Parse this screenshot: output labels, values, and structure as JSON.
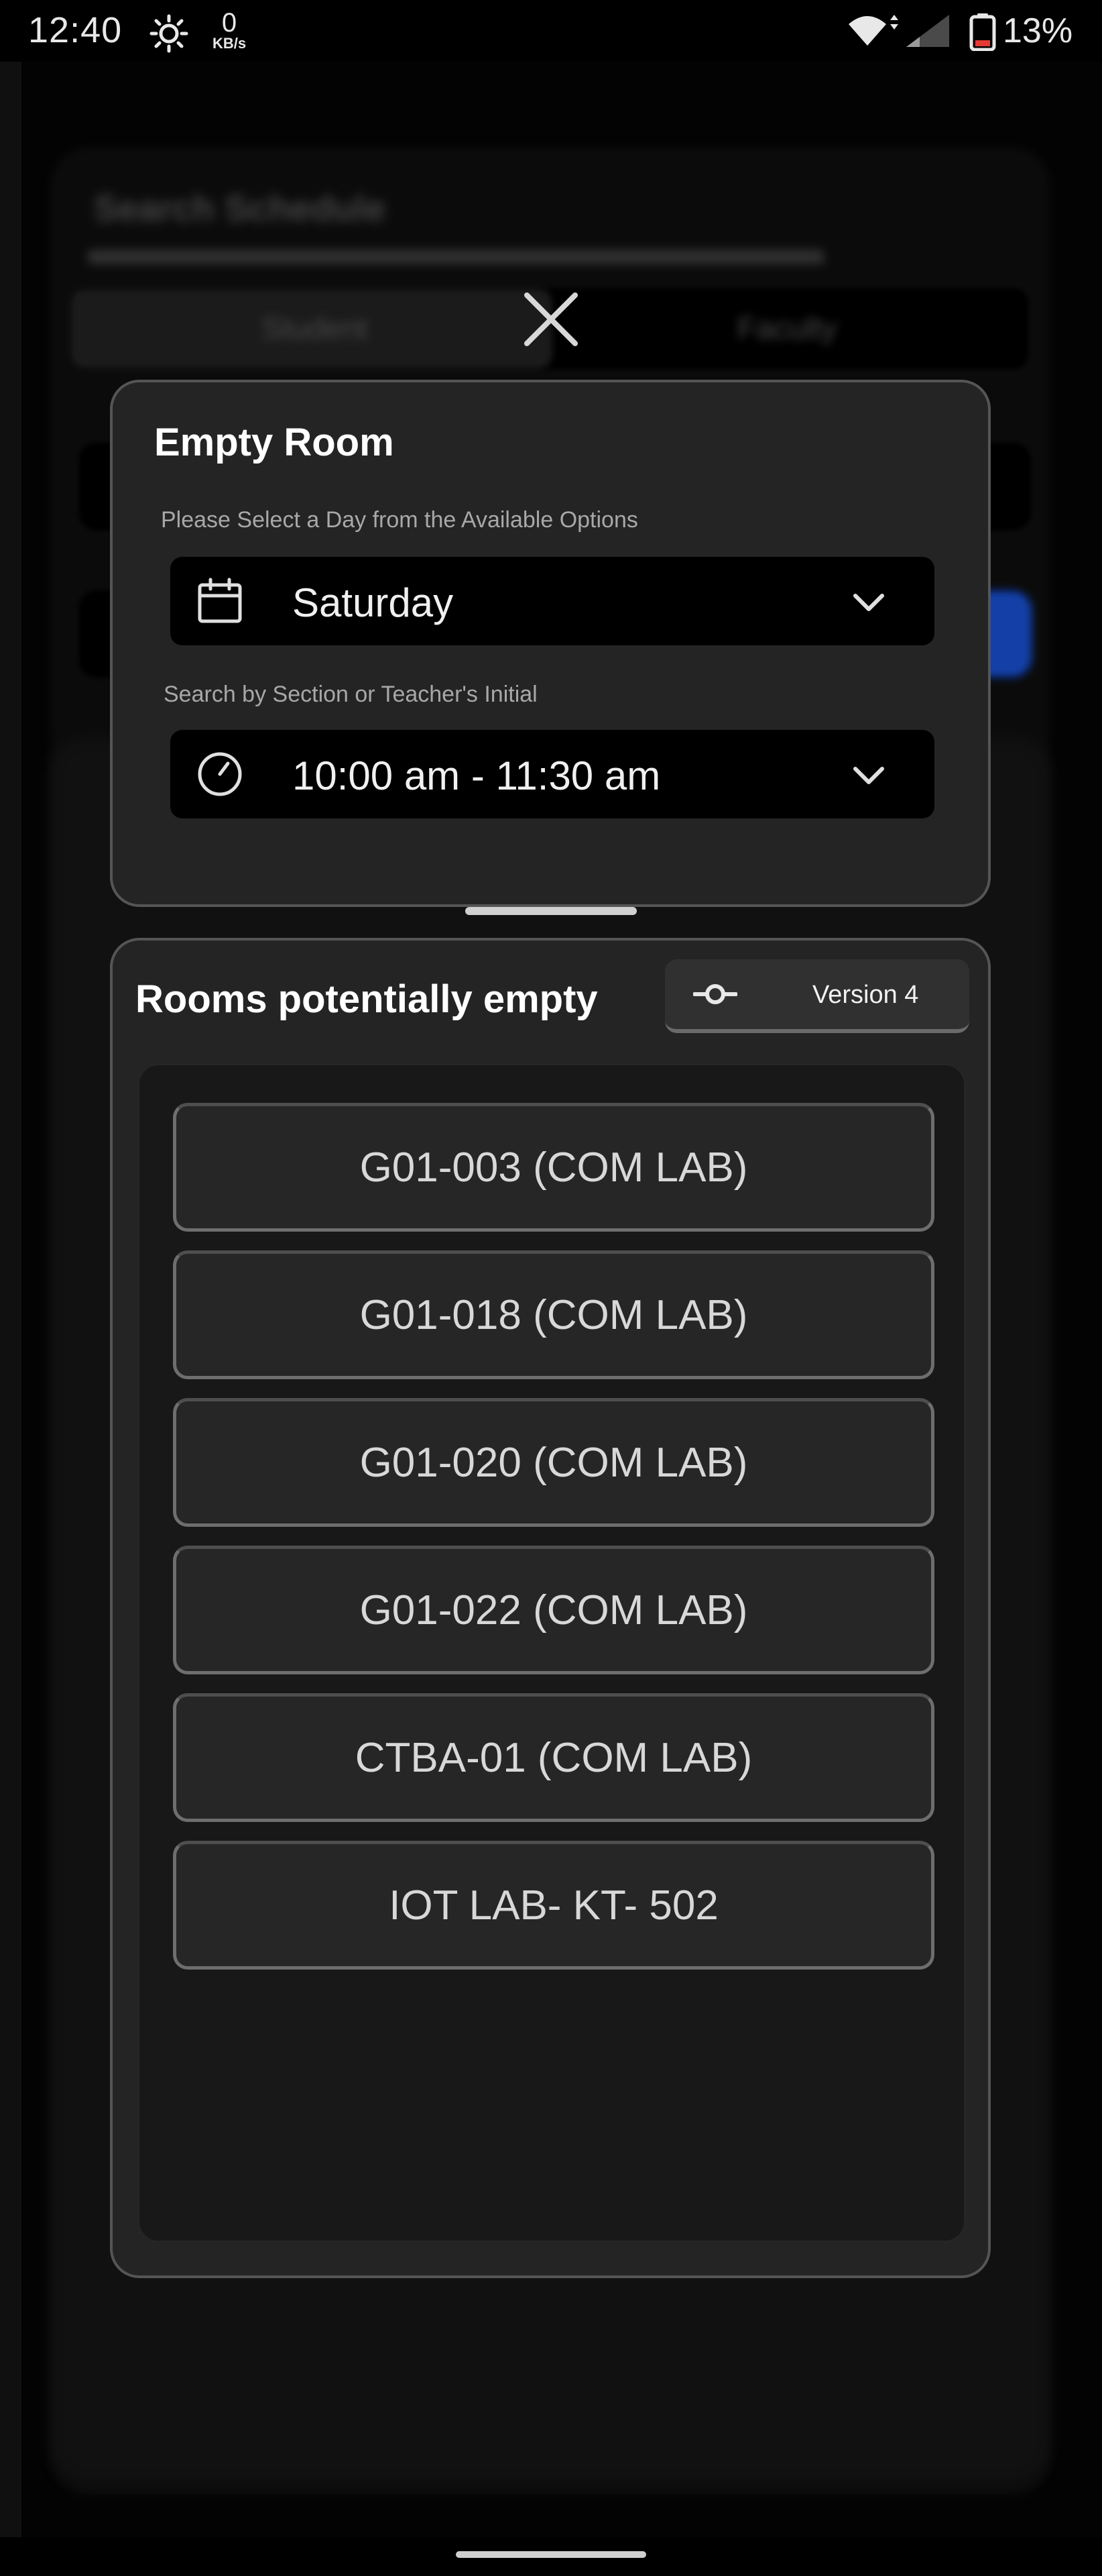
{
  "status_bar": {
    "time": "12:40",
    "net_speed_value": "0",
    "net_speed_unit": "KB/s",
    "battery_percent": "13%",
    "icons": [
      "brightness-icon",
      "wifi-icon",
      "signal-icon",
      "battery-icon"
    ]
  },
  "background": {
    "title": "Search Schedule",
    "tab_student": "Student",
    "tab_faculty": "Faculty"
  },
  "empty_room": {
    "title": "Empty Room",
    "day_label": "Please Select a Day from the Available Options",
    "day_value": "Saturday",
    "time_label": "Search by Section or Teacher's Initial",
    "time_value": "10:00 am - 11:30 am"
  },
  "rooms": {
    "title": "Rooms potentially empty",
    "version_label": "Version 4",
    "items": [
      "G01-003 (COM LAB)",
      "G01-018 (COM LAB)",
      "G01-020 (COM LAB)",
      "G01-022 (COM LAB)",
      "CTBA-01 (COM LAB)",
      "IOT LAB- KT- 502"
    ]
  },
  "colors": {
    "card_bg": "#242424",
    "card_border": "#555555",
    "select_bg": "#000000",
    "accent_blue": "#1f62ff"
  }
}
